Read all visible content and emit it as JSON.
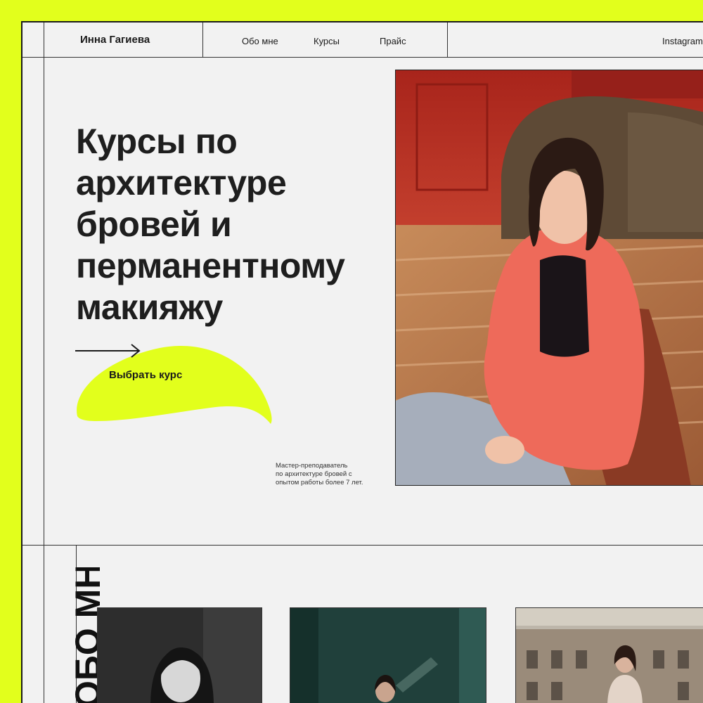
{
  "header": {
    "brand": "Инна Гагиева",
    "nav": [
      {
        "label": "Обо мне"
      },
      {
        "label": "Курсы"
      },
      {
        "label": "Прайс"
      }
    ],
    "social": "Instagram"
  },
  "hero": {
    "title_lines": [
      "Курсы по",
      "архитектуре",
      "бровей  и",
      "перманентному",
      "макияжу"
    ],
    "cta_label": "Выбрать курс",
    "caption_lines": [
      "Мастер-преподаватель",
      "по архитектуре бровей с",
      "опытом работы более 7 лет."
    ]
  },
  "about": {
    "heading": "ОБО МНЕ"
  },
  "colors": {
    "accent": "#e2ff1c",
    "background": "#f2f2f2",
    "text": "#1e1e1e"
  }
}
